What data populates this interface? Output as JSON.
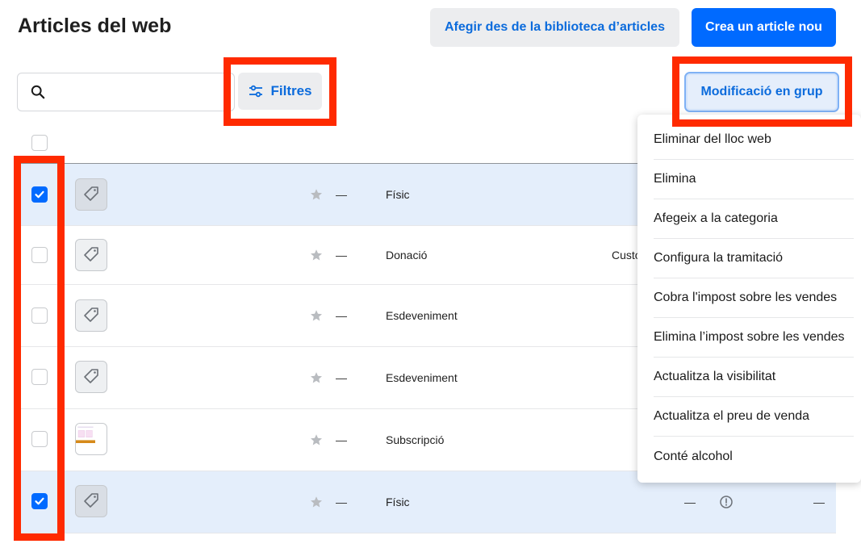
{
  "header": {
    "title": "Articles del web",
    "add_from_library_label": "Afegir des de la biblioteca d’articles",
    "create_label": "Crea un article nou"
  },
  "toolbar": {
    "search_placeholder": "",
    "search_value": "",
    "filters_label": "Filtres",
    "bulk_edit_label": "Modificació en grup"
  },
  "rows": [
    {
      "checked": true,
      "thumb": "tag-icon",
      "dash": "—",
      "type": "Físic"
    },
    {
      "checked": false,
      "thumb": "tag-icon",
      "dash": "—",
      "type": "Donació",
      "extra": "Custo"
    },
    {
      "checked": false,
      "thumb": "tag-icon",
      "dash": "—",
      "type": "Esdeveniment"
    },
    {
      "checked": false,
      "thumb": "tag-icon",
      "dash": "—",
      "type": "Esdeveniment"
    },
    {
      "checked": false,
      "thumb": "subscription-image",
      "dash": "—",
      "type": "Subscripció"
    },
    {
      "checked": true,
      "thumb": "tag-icon",
      "dash": "—",
      "type": "Físic",
      "col_a": "—",
      "col_b": "—"
    }
  ],
  "bulk_menu": {
    "items": [
      "Eliminar del lloc web",
      "Elimina",
      "Afegeix a la categoria",
      "Configura la tramitació",
      "Cobra l'impost sobre les vendes",
      "Elimina l’impost sobre les vendes",
      "Actualitza la visibilitat",
      "Actualitza el preu de venda",
      "Conté alcohol"
    ]
  },
  "colors": {
    "accent": "#006aff",
    "highlight": "#ff2a00",
    "selected_row": "#e4eefb"
  }
}
